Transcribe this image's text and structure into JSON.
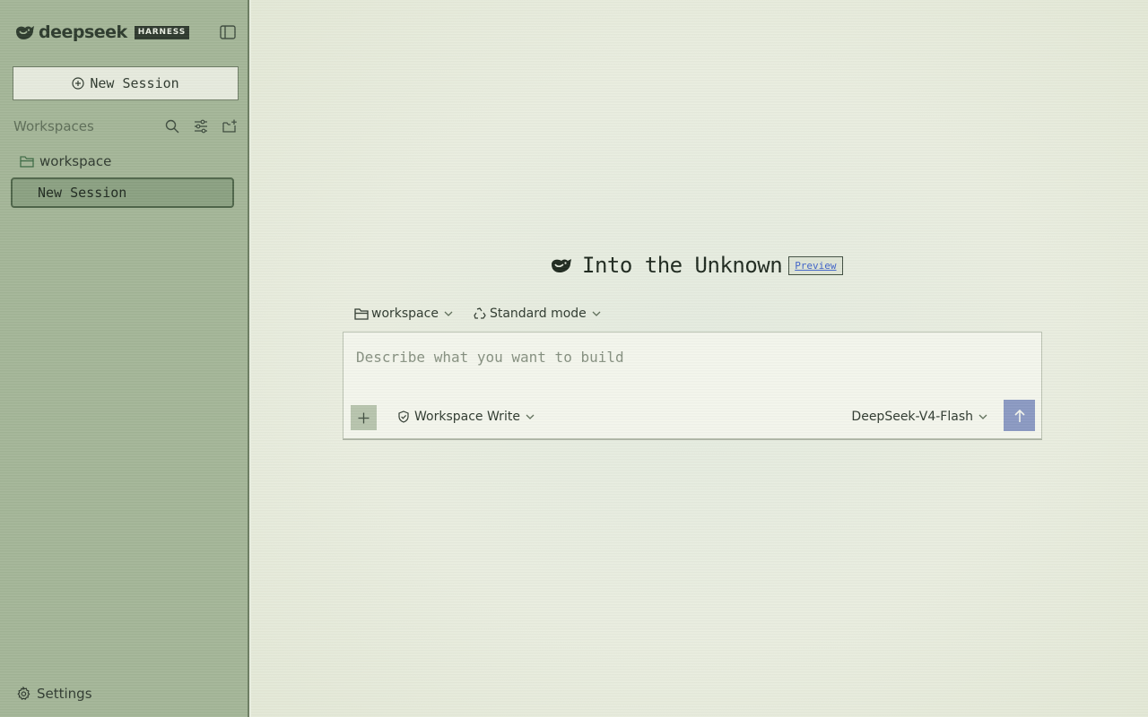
{
  "sidebar": {
    "brand": {
      "name": "deepseek",
      "badge": "HARNESS"
    },
    "new_session_label": "New Session",
    "workspaces_title": "Workspaces",
    "workspace_tools": [
      "search-icon",
      "filter-icon",
      "add-folder-icon"
    ],
    "folder": {
      "label": "workspace",
      "icon": "folder-icon"
    },
    "active_session": {
      "label": "New Session"
    },
    "settings_label": "Settings"
  },
  "hero": {
    "title": "Into the Unknown",
    "badge": "Preview",
    "icon": "whale-icon"
  },
  "selectors": {
    "workspace": "workspace",
    "mode": "Standard mode"
  },
  "composer": {
    "placeholder": "Describe what you want to build",
    "permission": "Workspace Write",
    "model": "DeepSeek-V4-Flash"
  },
  "colors": {
    "sidebar_bg": "#a3b597",
    "main_bg": "#e8ede0",
    "active_item": "#8aa081",
    "send_button": "#8a99c2",
    "preview_link": "#3f62c9"
  }
}
